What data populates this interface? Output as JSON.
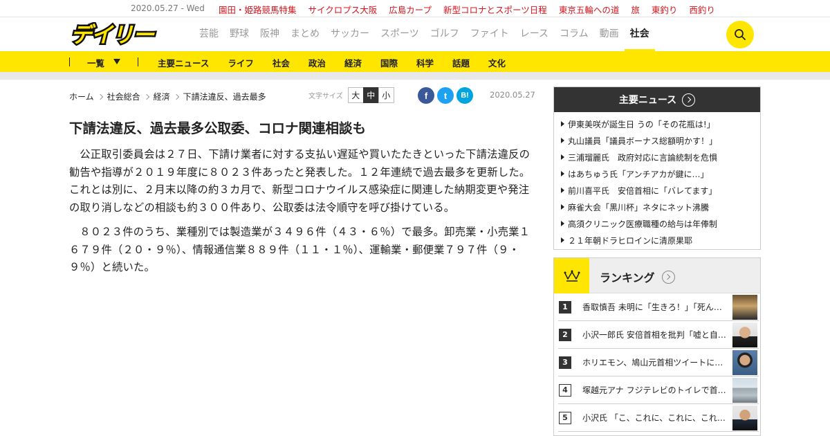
{
  "topbar": {
    "date": "2020.05.27 - Wed",
    "links": [
      "園田・姫路競馬特集",
      "サイクロプス大阪",
      "広島カープ",
      "新型コロナとスポーツ日程",
      "東京五輪への道",
      "旅",
      "東釣り",
      "西釣り"
    ]
  },
  "header": {
    "logo_text": "デイリー",
    "nav": [
      "芸能",
      "野球",
      "阪神",
      "まとめ",
      "サッカー",
      "スポーツ",
      "ゴルフ",
      "ファイト",
      "レース",
      "コラム",
      "動画",
      "社会"
    ],
    "active_nav": "社会"
  },
  "subnav": {
    "all_label": "一覧",
    "links": [
      "主要ニュース",
      "ライフ",
      "社会",
      "政治",
      "経済",
      "国際",
      "科学",
      "話題",
      "文化"
    ]
  },
  "breadcrumb": [
    "ホーム",
    "社会総合",
    "経済",
    "下請法違反、過去最多"
  ],
  "fontsize": {
    "label": "文字サイズ",
    "large": "大",
    "medium": "中",
    "small": "小"
  },
  "share": {
    "facebook": "f",
    "twitter": "t",
    "hatena": "B!"
  },
  "article": {
    "date": "2020.05.27",
    "title": "下請法違反、過去最多公取委、コロナ関連相談も",
    "paragraphs": [
      "公正取引委員会は２７日、下請け業者に対する支払い遅延や買いたたきといった下請法違反の勧告や指導が２０１９年度に８０２３件あったと発表した。１２年連続で過去最多を更新した。これとは別に、２月末以降の約３カ月で、新型コロナウイルス感染症に関連した納期変更や発注の取り消しなどの相談も約３００件あり、公取委は法令順守を呼び掛けている。",
      "８０２３件のうち、業種別では製造業が３４９６件（４３・６％）で最多。卸売業・小売業１６７９件（２０・９％）、情報通信業８８９件（１１・１％）、運輸業・郵便業７９７件（９・９％）と続いた。"
    ]
  },
  "main_news": {
    "title": "主要ニュース",
    "items": [
      "伊東美咲が誕生日 うの「その花瓶は!」",
      "丸山議員「議員ボーナス総額明かす！」",
      "三浦瑠麗氏　政府対応に言論統制を危惧",
      "はあちゅう氏「アンチアカが鍵に…」",
      "前川喜平氏　安倍首相に「バレてます」",
      "麻雀大会「黒川杯」ネタにネット沸騰",
      "高須クリニック医療職種の給与は年俸制",
      "２１年朝ドラヒロインに清原果耶"
    ]
  },
  "ranking": {
    "title": "ランキング",
    "items": [
      {
        "rank": "1",
        "text": "香取慎吾 未明に「生きろ！」「死んじゃダメ」"
      },
      {
        "rank": "2",
        "text": "小沢一郎氏 安倍首相を批判「嘘と自己保身」"
      },
      {
        "rank": "3",
        "text": "ホリエモン、鳩山元首相ツイートに猛反論"
      },
      {
        "rank": "4",
        "text": "塚越元アナ フジテレビのトイレで首を…"
      },
      {
        "rank": "5",
        "text": "小沢氏 「こ、これに、これに、これは…」"
      }
    ]
  },
  "colors": {
    "brand_yellow": "#ffe600",
    "top_link_red": "#d8141c",
    "dark": "#333333"
  }
}
